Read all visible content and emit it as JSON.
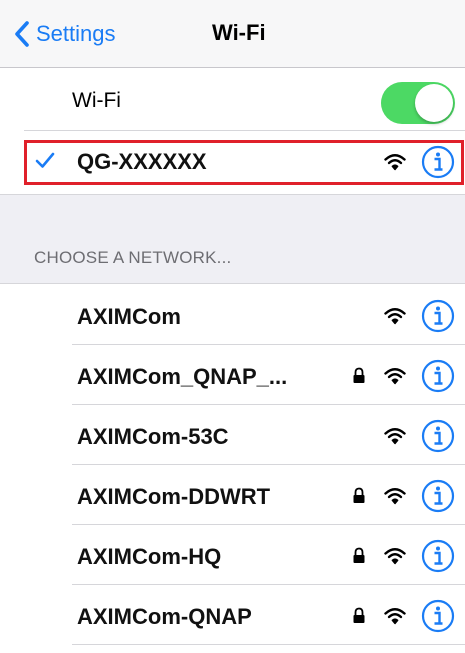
{
  "navbar": {
    "back_label": "Settings",
    "title": "Wi-Fi",
    "accent_color": "#1a7cf5"
  },
  "wifi_toggle": {
    "label": "Wi-Fi",
    "state": "on",
    "on_color": "#4cd964"
  },
  "connected_network": {
    "name": "QG-XXXXXX",
    "checked": true,
    "secured": false,
    "icons": [
      "checkmark-icon",
      "wifi-signal-icon",
      "info-icon"
    ],
    "highlight_color": "#e0202a"
  },
  "choose_section": {
    "header": "CHOOSE A NETWORK..."
  },
  "networks": [
    {
      "name": "AXIMCom",
      "secured": false
    },
    {
      "name": "AXIMCom_QNAP_...",
      "secured": true
    },
    {
      "name": "AXIMCom-53C",
      "secured": false
    },
    {
      "name": "AXIMCom-DDWRT",
      "secured": true
    },
    {
      "name": "AXIMCom-HQ",
      "secured": true
    },
    {
      "name": "AXIMCom-QNAP",
      "secured": true
    }
  ]
}
